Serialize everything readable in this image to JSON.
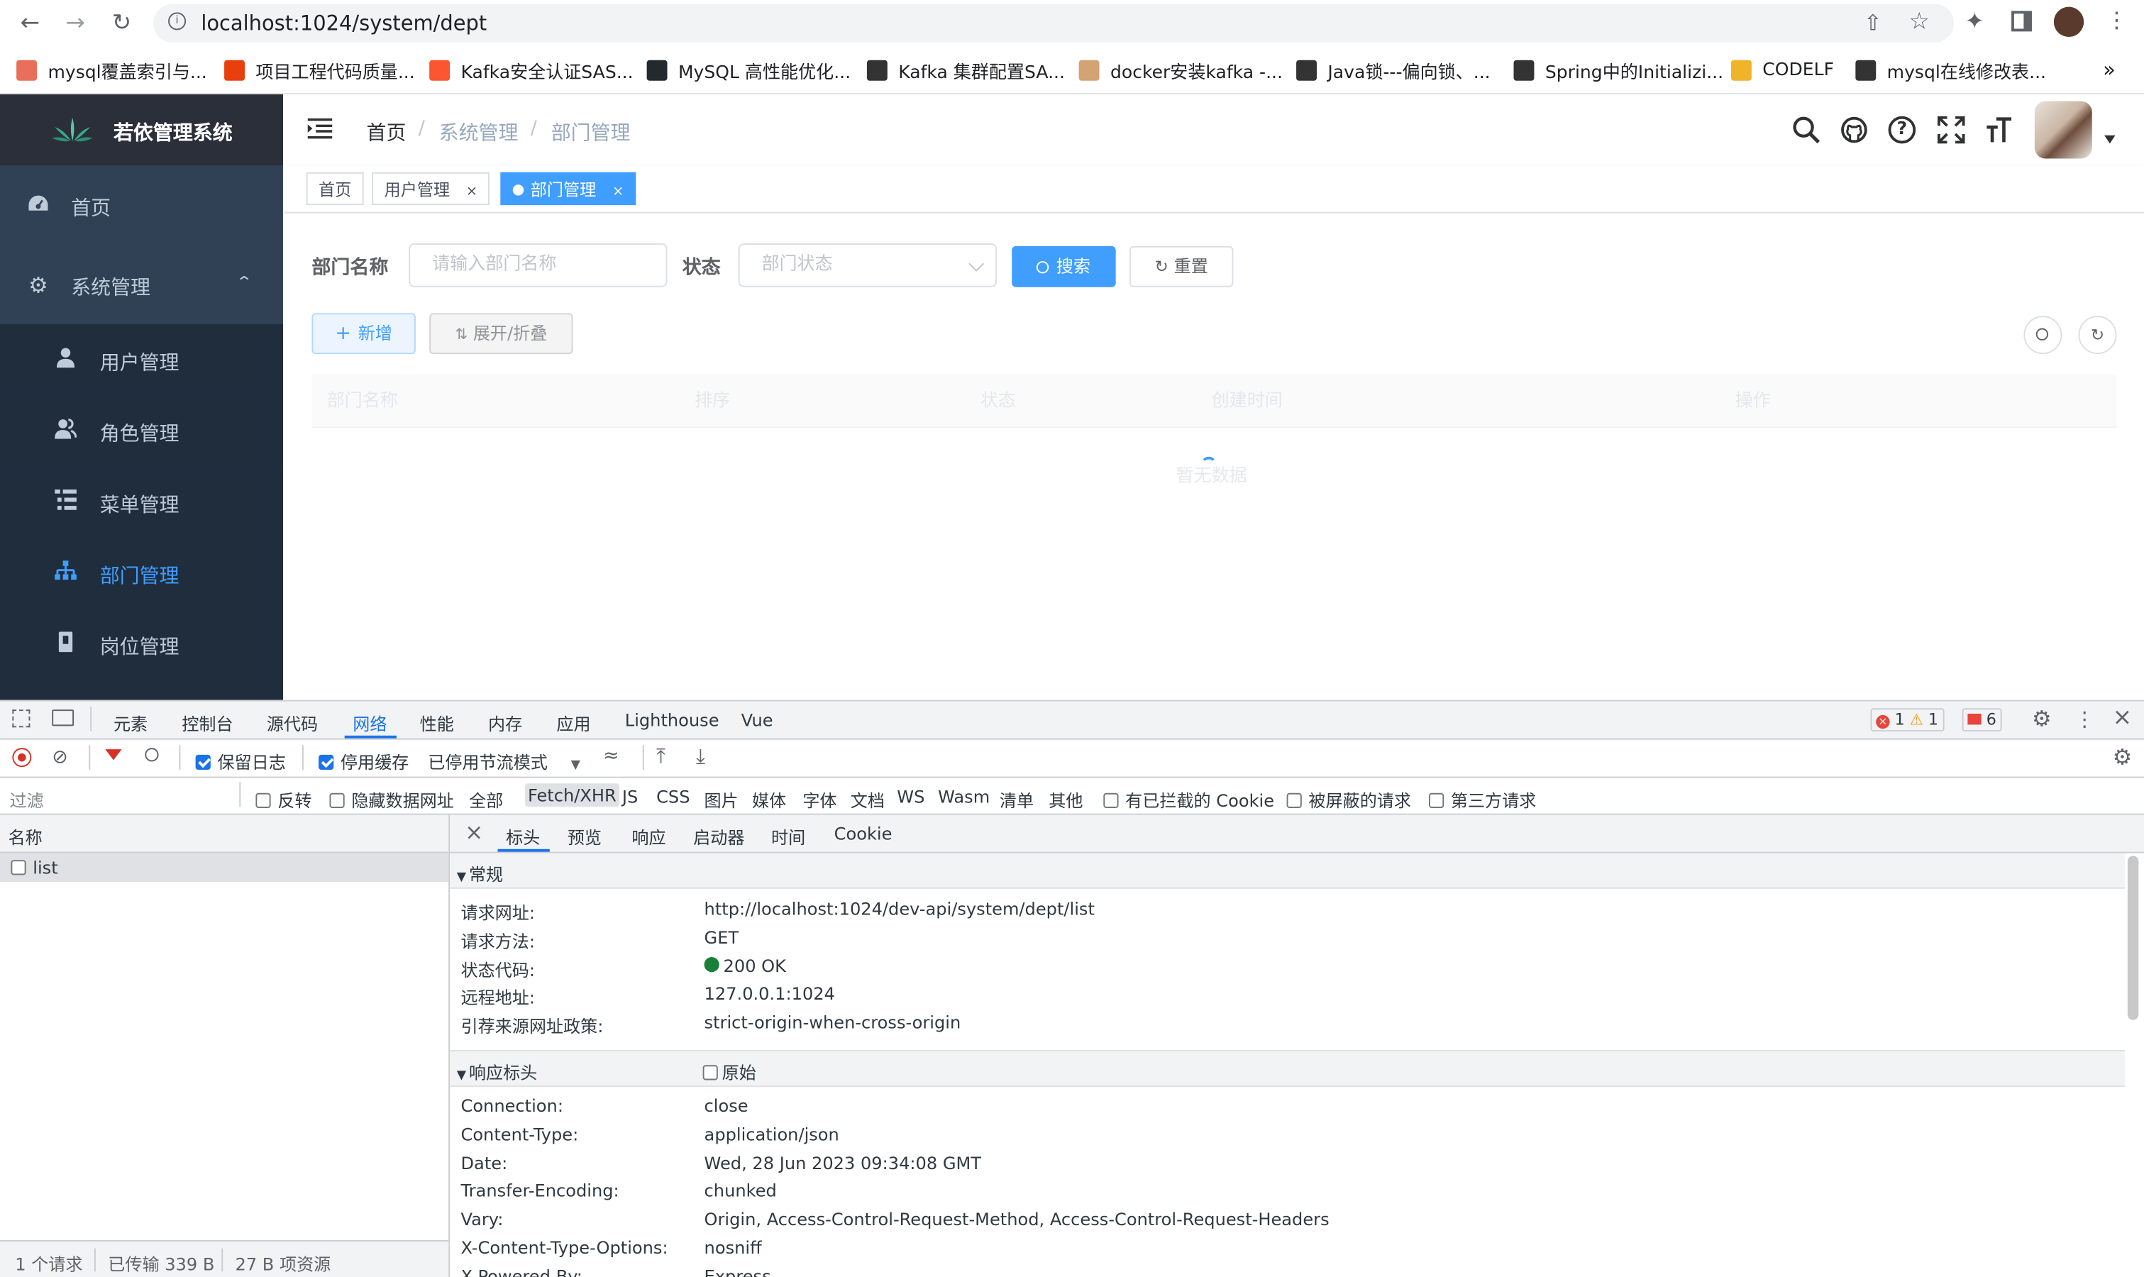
{
  "browser": {
    "url": "localhost:1024/system/dept",
    "bookmarks": [
      {
        "label": "mysql覆盖索引与...",
        "icon": "jianshu-icon",
        "color": "#ea6f5a"
      },
      {
        "label": "项目工程代码质量...",
        "icon": "fire-icon",
        "color": "#e8400c"
      },
      {
        "label": "Kafka安全认证SAS...",
        "icon": "csdn-icon",
        "color": "#fc5531"
      },
      {
        "label": "MySQL 高性能优化...",
        "icon": "github-icon",
        "color": "#24292e"
      },
      {
        "label": "Kafka 集群配置SA...",
        "icon": "cnblogs-icon",
        "color": "#333333"
      },
      {
        "label": "docker安装kafka -...",
        "icon": "juejin-icon",
        "color": "#d4a373"
      },
      {
        "label": "Java锁---偏向锁、...",
        "icon": "cnblogs-icon",
        "color": "#333333"
      },
      {
        "label": "Spring中的Initializi...",
        "icon": "cnblogs-icon",
        "color": "#333333"
      },
      {
        "label": "CODELF",
        "icon": "codelf-icon",
        "color": "#f0b429"
      },
      {
        "label": "mysql在线修改表...",
        "icon": "cnblogs-icon",
        "color": "#333333"
      }
    ],
    "more_bookmarks": "»"
  },
  "app": {
    "title": "若依管理系统",
    "menu": {
      "home": "首页",
      "system": "系统管理",
      "items": [
        {
          "label": "用户管理",
          "icon": "user-icon"
        },
        {
          "label": "角色管理",
          "icon": "peoples-icon"
        },
        {
          "label": "菜单管理",
          "icon": "tree-table-icon"
        },
        {
          "label": "部门管理",
          "icon": "tree-icon"
        },
        {
          "label": "岗位管理",
          "icon": "post-icon"
        }
      ],
      "active_color": "#409eff"
    },
    "breadcrumb": [
      "首页",
      "系统管理",
      "部门管理"
    ],
    "breadcrumb_sep": "/",
    "tags": [
      {
        "label": "首页",
        "closable": false
      },
      {
        "label": "用户管理",
        "closable": true
      },
      {
        "label": "部门管理",
        "closable": true,
        "active": true
      }
    ],
    "tag_close": "×",
    "search": {
      "dept_name_label": "部门名称",
      "dept_name_placeholder": "请输入部门名称",
      "status_label": "状态",
      "status_placeholder": "部门状态",
      "search_btn": "搜索",
      "reset_btn": "重置"
    },
    "toolbar": {
      "add_btn": "新增",
      "expand_btn": "展开/折叠"
    },
    "table": {
      "columns": [
        "部门名称",
        "排序",
        "状态",
        "创建时间",
        "操作"
      ],
      "empty_text": "暂无数据"
    }
  },
  "devtools": {
    "tabs": [
      "元素",
      "控制台",
      "源代码",
      "网络",
      "性能",
      "内存",
      "应用",
      "Lighthouse",
      "Vue"
    ],
    "active_tab": "网络",
    "badges": {
      "errors": "1",
      "warnings": "1",
      "issues": "6"
    },
    "network_toolbar": {
      "preserve_log": "保留日志",
      "disable_cache": "停用缓存",
      "throttling": "已停用节流模式"
    },
    "filter": {
      "placeholder": "过滤",
      "invert": "反转",
      "hide_data_urls": "隐藏数据网址",
      "types": [
        "全部",
        "Fetch/XHR",
        "JS",
        "CSS",
        "图片",
        "媒体",
        "字体",
        "文档",
        "WS",
        "Wasm",
        "清单",
        "其他"
      ],
      "active_type": "Fetch/XHR",
      "blocked_cookies": "有已拦截的 Cookie",
      "blocked_requests": "被屏蔽的请求",
      "third_party": "第三方请求"
    },
    "request_list": {
      "header": "名称",
      "items": [
        "list"
      ],
      "summary": [
        "1 个请求",
        "已传输 339 B",
        "27 B 项资源"
      ]
    },
    "detail_tabs": [
      "标头",
      "预览",
      "响应",
      "启动器",
      "时间",
      "Cookie"
    ],
    "active_detail_tab": "标头",
    "general": {
      "title": "常规",
      "rows": [
        {
          "key": "请求网址:",
          "value": "http://localhost:1024/dev-api/system/dept/list"
        },
        {
          "key": "请求方法:",
          "value": "GET"
        },
        {
          "key": "状态代码:",
          "value": "200 OK"
        },
        {
          "key": "远程地址:",
          "value": "127.0.0.1:1024"
        },
        {
          "key": "引荐来源网址政策:",
          "value": "strict-origin-when-cross-origin"
        }
      ]
    },
    "response_headers": {
      "title": "响应标头",
      "raw_label": "原始",
      "rows": [
        {
          "key": "Connection:",
          "value": "close"
        },
        {
          "key": "Content-Type:",
          "value": "application/json"
        },
        {
          "key": "Date:",
          "value": "Wed, 28 Jun 2023 09:34:08 GMT"
        },
        {
          "key": "Transfer-Encoding:",
          "value": "chunked"
        },
        {
          "key": "Vary:",
          "value": "Origin, Access-Control-Request-Method, Access-Control-Request-Headers"
        },
        {
          "key": "X-Content-Type-Options:",
          "value": "nosniff"
        },
        {
          "key": "X-Powered-By:",
          "value": "Express"
        }
      ]
    }
  }
}
